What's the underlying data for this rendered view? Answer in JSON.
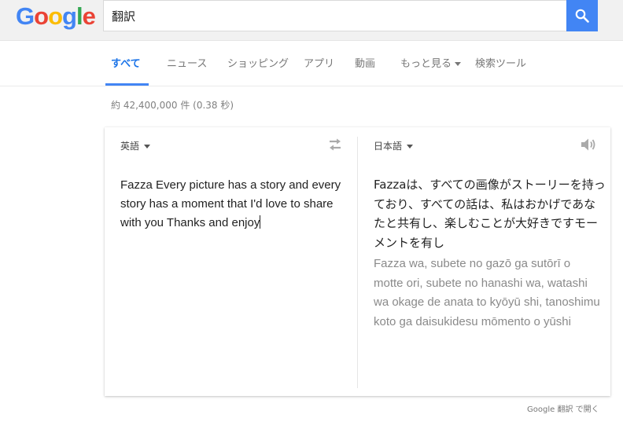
{
  "logo": {
    "letters": [
      "G",
      "o",
      "o",
      "g",
      "l",
      "e"
    ],
    "colors": [
      "#4285f4",
      "#ea4335",
      "#fbbc05",
      "#4285f4",
      "#34a853",
      "#ea4335"
    ]
  },
  "search": {
    "value": "翻訳",
    "button_icon": "search-icon"
  },
  "tabs": [
    {
      "label": "すべて"
    },
    {
      "label": "ニュース"
    },
    {
      "label": "ショッピング"
    },
    {
      "label": "アプリ"
    },
    {
      "label": "動画"
    },
    {
      "label": "もっと見る"
    },
    {
      "label": "検索ツール"
    }
  ],
  "result_stats": "約 42,400,000 件 (0.38 秒)",
  "translator": {
    "source_lang": "英語",
    "target_lang": "日本語",
    "source_text": "Fazza Every picture has a story and every story has a moment that I'd love to share with you Thanks and enjoy",
    "target_text": "Fazzaは、すべての画像がストーリーを持っており、すべての話は、私はおかげであなたと共有し、楽しむことが大好きですモーメントを有し",
    "romaji": "Fazza wa, subete no gazō ga sutōrī o motte ori, subete no hanashi wa, watashi wa okage de anata to kyōyū shi, tanoshimu koto ga daisukidesu mōmento o yūshi"
  },
  "open_in": "Google 翻訳 で開く",
  "colors": {
    "accent": "#4285f4",
    "active_tab": "#1a73e8"
  }
}
